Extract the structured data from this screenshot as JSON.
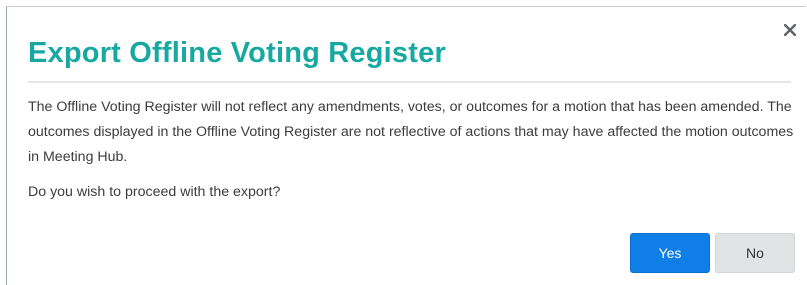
{
  "dialog": {
    "title": "Export Offline Voting Register",
    "message": "The Offline Voting Register will not reflect any amendments, votes, or outcomes for a motion that has been amended. The outcomes displayed in the Offline Voting Register are not reflective of actions that may have affected the motion outcomes in Meeting Hub.",
    "question": "Do you wish to proceed with the export?",
    "close_icon": "close-icon",
    "yes_label": "Yes",
    "no_label": "No"
  },
  "colors": {
    "title": "#17a9a1",
    "primary_button": "#0f7ee6",
    "secondary_button": "#e2e3e5",
    "text": "#3c3c3c"
  }
}
